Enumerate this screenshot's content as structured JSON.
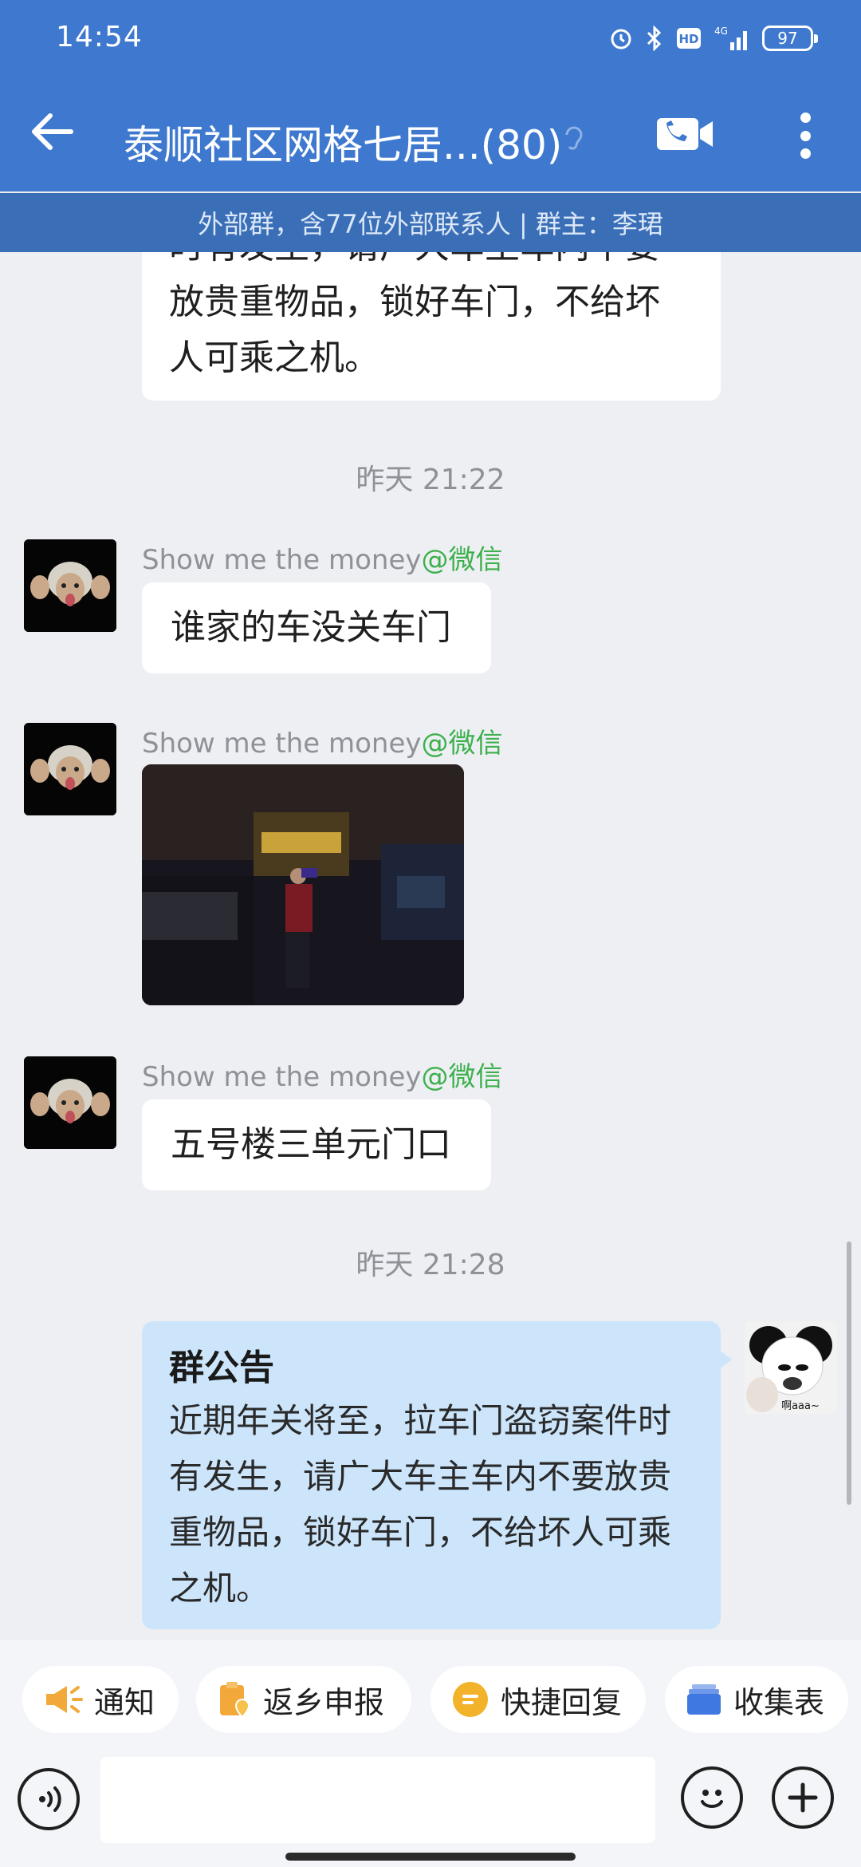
{
  "status_bar": {
    "time": "14:54",
    "battery": "97",
    "network": "4G"
  },
  "header": {
    "title": "泰顺社区网格七居...(80)",
    "subtitle": "外部群，含77位外部联系人 | 群主：李珺"
  },
  "messages": {
    "partial_text": "时有发生，请广大车主车内不要放贵重物品，锁好车门，不给坏人可乘之机。",
    "timestamp_1": "昨天  21:22",
    "sender_name": "Show me the money",
    "sender_tag": "@微信",
    "msg_1": "谁家的车没关车门",
    "msg_3": "五号楼三单元门口",
    "timestamp_2": "昨天  21:28",
    "announcement": {
      "title": "群公告",
      "body": "近期年关将至，拉车门盗窃案件时有发生，请广大车主车内不要放贵重物品，锁好车门，不给坏人可乘之机。"
    },
    "my_avatar_text": "啊aaa~"
  },
  "quick_actions": {
    "notify": "通知",
    "return_report": "返乡申报",
    "quick_reply": "快捷回复",
    "collect_form": "收集表"
  },
  "input": {
    "value": ""
  },
  "colors": {
    "header": "#3e79cf",
    "subbar": "#3a6fb8",
    "wechat_tag": "#3cb04d",
    "announcement_bg": "#cce5fb"
  }
}
